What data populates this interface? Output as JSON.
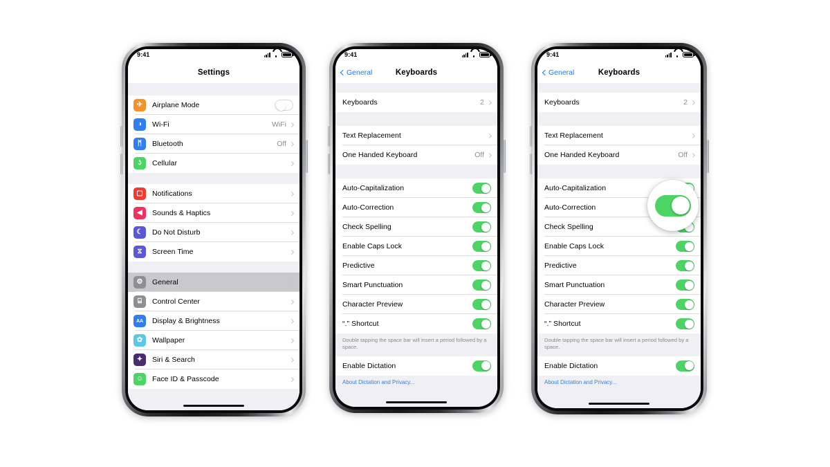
{
  "status_bar": {
    "time": "9:41",
    "signal_icon": "cellular-signal-icon",
    "wifi_icon": "wifi-icon",
    "battery_icon": "battery-full-icon"
  },
  "phone1": {
    "nav": {
      "title": "Settings"
    },
    "group1": [
      {
        "label": "Airplane Mode",
        "icon": "airplane-icon",
        "color": "#f3912a",
        "glyph": "✈",
        "control": "toggle",
        "toggle_on": false
      },
      {
        "label": "Wi-Fi",
        "icon": "wifi-icon",
        "color": "#2f7ff0",
        "glyph": "◑",
        "control": "value",
        "value": "WiFi"
      },
      {
        "label": "Bluetooth",
        "icon": "bluetooth-icon",
        "color": "#2f7ff0",
        "glyph": "ᛗ",
        "control": "value",
        "value": "Off"
      },
      {
        "label": "Cellular",
        "icon": "cellular-icon",
        "color": "#4cd464",
        "glyph": "ʖ",
        "control": "chevron",
        "value": ""
      }
    ],
    "group2": [
      {
        "label": "Notifications",
        "icon": "notifications-icon",
        "color": "#f03b34",
        "glyph": "▢",
        "control": "chevron",
        "value": ""
      },
      {
        "label": "Sounds & Haptics",
        "icon": "sounds-haptics-icon",
        "color": "#f0325c",
        "glyph": "◀",
        "control": "chevron",
        "value": ""
      },
      {
        "label": "Do Not Disturb",
        "icon": "do-not-disturb-icon",
        "color": "#5a58d6",
        "glyph": "☾",
        "control": "chevron",
        "value": ""
      },
      {
        "label": "Screen Time",
        "icon": "screen-time-icon",
        "color": "#5a58d6",
        "glyph": "⧖",
        "control": "chevron",
        "value": ""
      }
    ],
    "group3": [
      {
        "label": "General",
        "icon": "gear-icon",
        "color": "#8e8e93",
        "glyph": "⚙",
        "control": "chevron",
        "value": "",
        "selected": true
      },
      {
        "label": "Control Center",
        "icon": "control-center-icon",
        "color": "#8e8e93",
        "glyph": "⌸",
        "control": "chevron",
        "value": ""
      },
      {
        "label": "Display & Brightness",
        "icon": "display-brightness-icon",
        "color": "#2f7ff0",
        "glyph": "AA",
        "control": "chevron",
        "value": ""
      },
      {
        "label": "Wallpaper",
        "icon": "wallpaper-icon",
        "color": "#5ac8e8",
        "glyph": "✿",
        "control": "chevron",
        "value": ""
      },
      {
        "label": "Siri & Search",
        "icon": "siri-search-icon",
        "color": "#4a2d6e",
        "glyph": "✦",
        "control": "chevron",
        "value": ""
      },
      {
        "label": "Face ID & Passcode",
        "icon": "face-id-icon",
        "color": "#4cd464",
        "glyph": "☺",
        "control": "chevron",
        "value": ""
      }
    ]
  },
  "phone2": {
    "nav": {
      "back_label": "General",
      "title": "Keyboards"
    },
    "group1": [
      {
        "label": "Keyboards",
        "value": "2",
        "control": "chevron"
      }
    ],
    "group2": [
      {
        "label": "Text Replacement",
        "value": "",
        "control": "chevron"
      },
      {
        "label": "One Handed Keyboard",
        "value": "Off",
        "control": "chevron"
      }
    ],
    "group3": [
      {
        "label": "Auto-Capitalization",
        "control": "toggle",
        "toggle_on": true
      },
      {
        "label": "Auto-Correction",
        "control": "toggle",
        "toggle_on": true
      },
      {
        "label": "Check Spelling",
        "control": "toggle",
        "toggle_on": true
      },
      {
        "label": "Enable Caps Lock",
        "control": "toggle",
        "toggle_on": true
      },
      {
        "label": "Predictive",
        "control": "toggle",
        "toggle_on": true
      },
      {
        "label": "Smart Punctuation",
        "control": "toggle",
        "toggle_on": true
      },
      {
        "label": "Character Preview",
        "control": "toggle",
        "toggle_on": true
      },
      {
        "label": "“.” Shortcut",
        "control": "toggle",
        "toggle_on": true
      }
    ],
    "footer_note": "Double tapping the space bar will insert a period followed by a space.",
    "group4": [
      {
        "label": "Enable Dictation",
        "control": "toggle",
        "toggle_on": true
      }
    ],
    "dictation_link": "About Dictation and Privacy..."
  },
  "phone3": {
    "nav": {
      "back_label": "General",
      "title": "Keyboards"
    },
    "group1": [
      {
        "label": "Keyboards",
        "value": "2",
        "control": "chevron"
      }
    ],
    "group2": [
      {
        "label": "Text Replacement",
        "value": "",
        "control": "chevron"
      },
      {
        "label": "One Handed Keyboard",
        "value": "Off",
        "control": "chevron"
      }
    ],
    "group3": [
      {
        "label": "Auto-Capitalization",
        "control": "toggle",
        "toggle_on": true
      },
      {
        "label": "Auto-Correction",
        "control": "toggle",
        "toggle_on": true
      },
      {
        "label": "Check Spelling",
        "control": "toggle",
        "toggle_on": true
      },
      {
        "label": "Enable Caps Lock",
        "control": "toggle",
        "toggle_on": true
      },
      {
        "label": "Predictive",
        "control": "toggle",
        "toggle_on": true
      },
      {
        "label": "Smart Punctuation",
        "control": "toggle",
        "toggle_on": true
      },
      {
        "label": "Character Preview",
        "control": "toggle",
        "toggle_on": true
      },
      {
        "label": "“.” Shortcut",
        "control": "toggle",
        "toggle_on": true
      }
    ],
    "footer_note": "Double tapping the space bar will insert a period followed by a space.",
    "group4": [
      {
        "label": "Enable Dictation",
        "control": "toggle",
        "toggle_on": true
      }
    ],
    "dictation_link": "About Dictation and Privacy...",
    "magnifier": {
      "target": "auto-correction-toggle",
      "toggle_on": true
    }
  },
  "colors": {
    "accent_blue": "#0a7cff",
    "toggle_green": "#4cd464",
    "list_bg": "#efeff4",
    "separator": "#dcdcdf",
    "secondary_text": "#8e8e93"
  }
}
